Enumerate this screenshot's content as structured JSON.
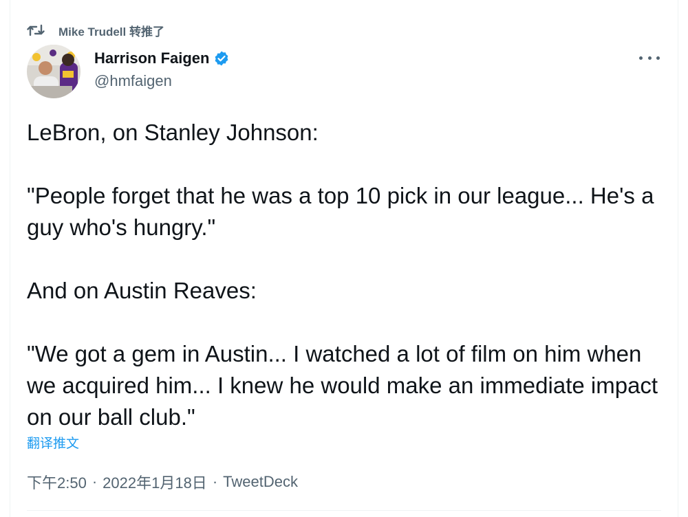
{
  "retweet": {
    "icon": "retweet-icon",
    "label": "Mike Trudell 转推了"
  },
  "author": {
    "name": "Harrison Faigen",
    "handle": "@hmfaigen",
    "verified": true,
    "verified_icon": "verified-badge-icon",
    "avatar_icon": "avatar-photo"
  },
  "more_icon": "more-options-icon",
  "tweet": {
    "paragraphs": [
      "LeBron, on Stanley Johnson:",
      "\"People forget that he was a top 10 pick in our league... He's a guy who's hungry.\"",
      "And on Austin Reaves:",
      "\"We got a gem in Austin... I watched a lot of film on him when we acquired him... I knew he would make an immediate impact on our ball club.\""
    ]
  },
  "translate_label": "翻译推文",
  "meta": {
    "time": "下午2:50",
    "date": "2022年1月18日",
    "source": "TweetDeck",
    "separator": "·"
  },
  "colors": {
    "text": "#0f1419",
    "secondary": "#536471",
    "link": "#1d9bf0",
    "verified": "#1d9bf0",
    "divider": "#eff3f4"
  }
}
